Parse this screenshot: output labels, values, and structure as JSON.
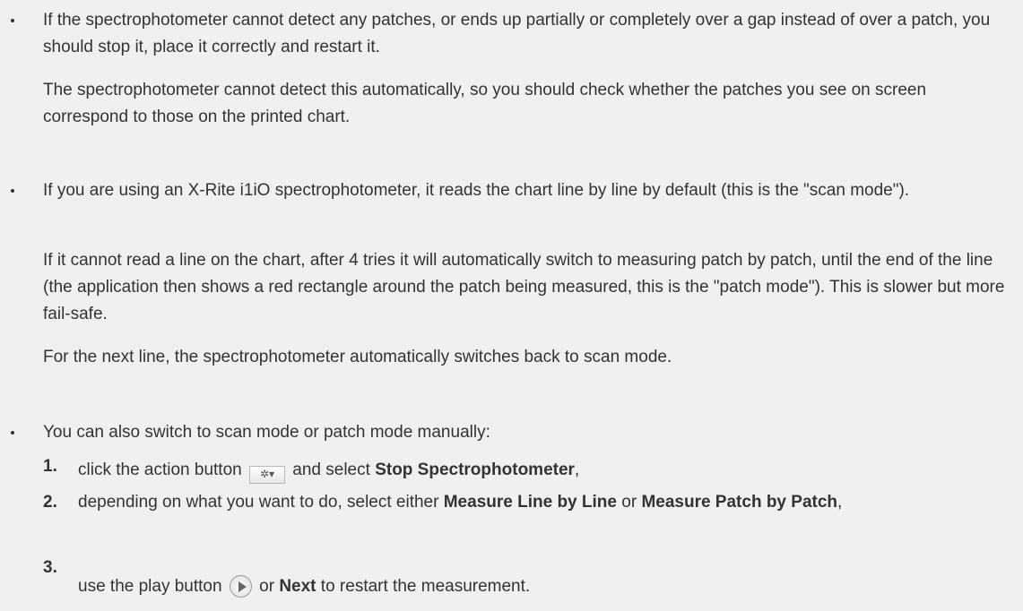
{
  "bullets": [
    {
      "para1": "If the spectrophotometer cannot detect any patches, or ends up partially or completely over a gap instead of over a patch, you should stop it, place it correctly and restart it.",
      "para2": "The spectrophotometer cannot detect this automatically, so you should check whether the patches you see on screen correspond to those on the printed chart."
    },
    {
      "para1": "If you are using an X-Rite i1iO spectrophotometer, it reads the chart line by line by default (this is the \"scan mode\").",
      "para2": "If it cannot read a line on the chart, after 4 tries it will automatically switch to measuring patch by patch, until the end of the line (the application then shows a red rectangle around the patch being measured, this is the \"patch mode\"). This is slower but more fail-safe.",
      "para3": "For the next line, the spectrophotometer automatically switches back to scan mode."
    },
    {
      "para1": "You can also switch to scan mode or patch mode manually:"
    }
  ],
  "steps": [
    {
      "num": "1.",
      "pre": "click the action button",
      "mid": "and select",
      "bold": "Stop Spectrophotometer",
      "post": ","
    },
    {
      "num": "2.",
      "pre": "depending on what you want to do, select either",
      "bold1": "Measure Line by Line",
      "mid": "or",
      "bold2": "Measure Patch by Patch",
      "post": ","
    },
    {
      "num": "3.",
      "pre": "use the play button",
      "mid": "or",
      "bold": "Next",
      "post": "to restart the measurement."
    }
  ],
  "icons": {
    "action": "gear-dropdown-icon",
    "action_glyph": "✲▾",
    "play": "play-icon"
  }
}
